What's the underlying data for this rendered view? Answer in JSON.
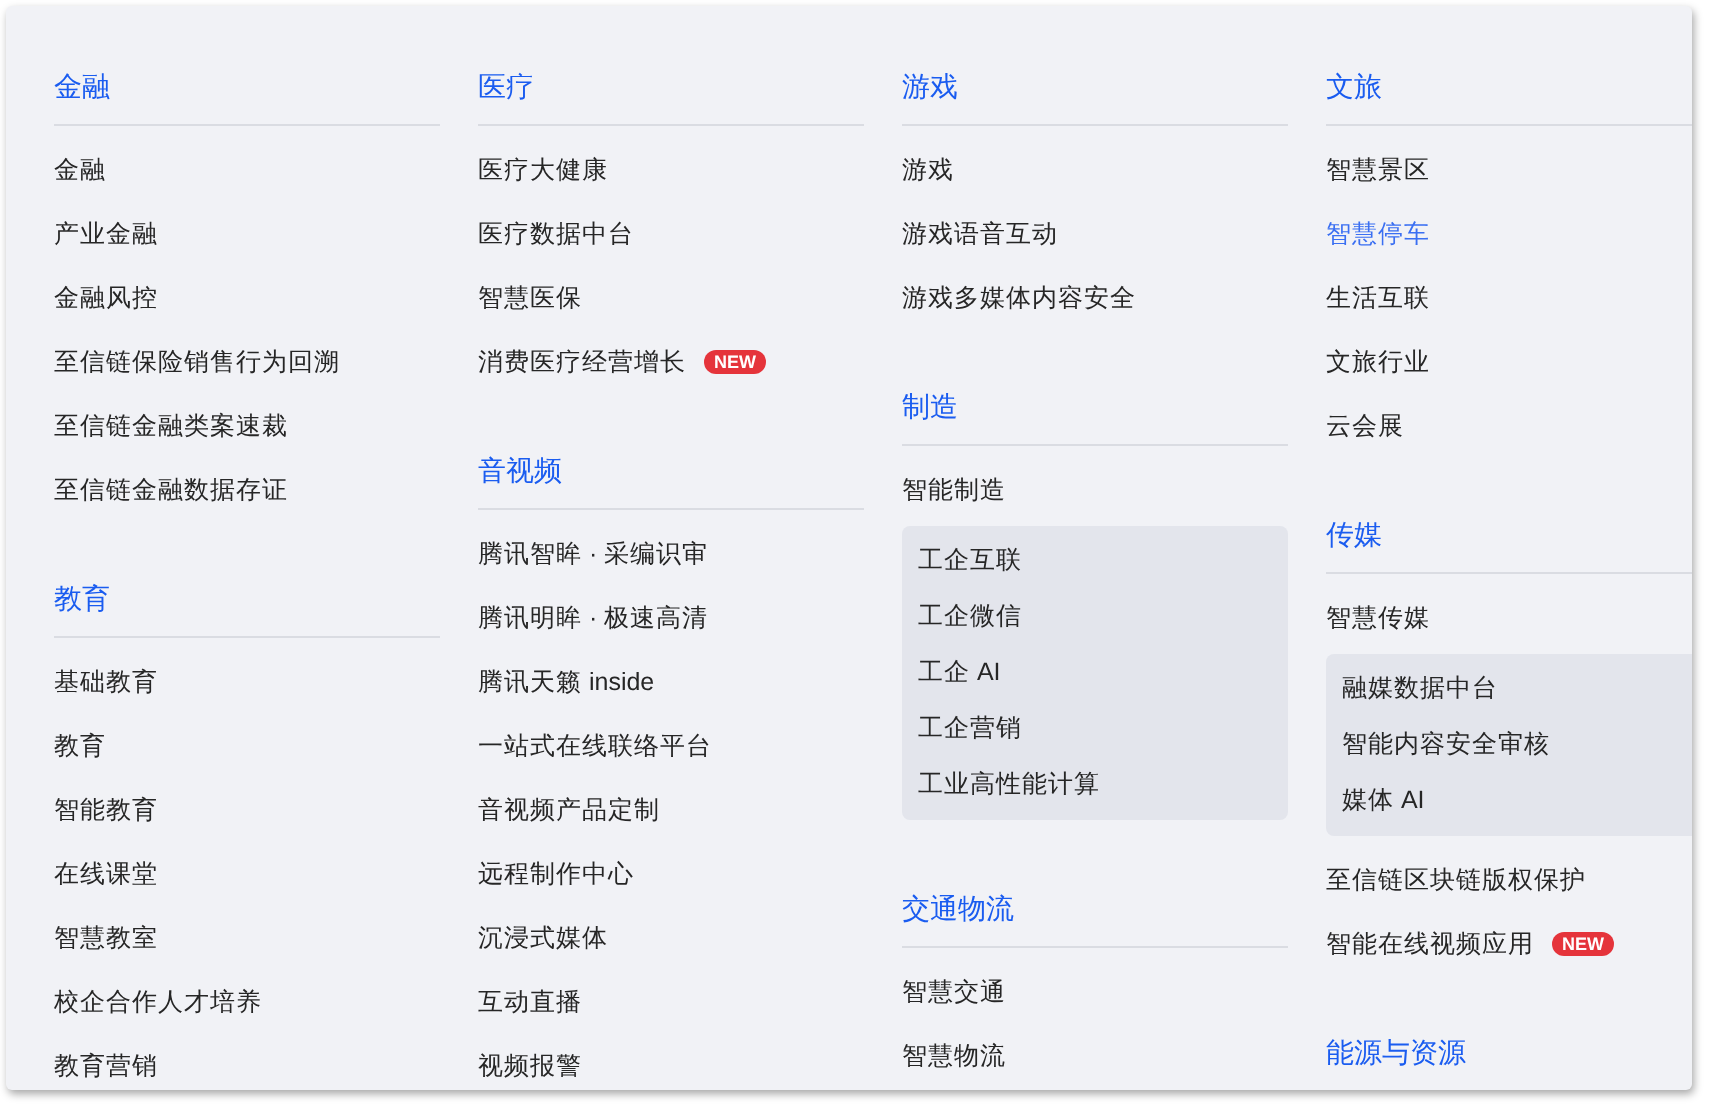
{
  "columns": [
    {
      "sections": [
        {
          "title": "金融",
          "items": [
            {
              "label": "金融",
              "hovered": false
            },
            {
              "label": "产业金融",
              "hovered": false
            },
            {
              "label": "金融风控",
              "hovered": false
            },
            {
              "label": "至信链保险销售行为回溯",
              "hovered": false
            },
            {
              "label": "至信链金融类案速裁",
              "hovered": false
            },
            {
              "label": "至信链金融数据存证",
              "hovered": false
            }
          ]
        },
        {
          "title": "教育",
          "items": [
            {
              "label": "基础教育",
              "hovered": false
            },
            {
              "label": "教育",
              "hovered": false
            },
            {
              "label": "智能教育",
              "hovered": false
            },
            {
              "label": "在线课堂",
              "hovered": false
            },
            {
              "label": "智慧教室",
              "hovered": false
            },
            {
              "label": "校企合作人才培养",
              "hovered": false
            },
            {
              "label": "教育营销",
              "hovered": false
            }
          ]
        }
      ]
    },
    {
      "sections": [
        {
          "title": "医疗",
          "items": [
            {
              "label": "医疗大健康",
              "hovered": false
            },
            {
              "label": "医疗数据中台",
              "hovered": false
            },
            {
              "label": "智慧医保",
              "hovered": false
            },
            {
              "label": "消费医疗经营增长",
              "hovered": false,
              "badge": "NEW"
            }
          ]
        },
        {
          "title": "音视频",
          "items": [
            {
              "label": "腾讯智眸 · 采编识审",
              "hovered": false
            },
            {
              "label": "腾讯明眸 · 极速高清",
              "hovered": false
            },
            {
              "label": "腾讯天籁 inside",
              "hovered": false
            },
            {
              "label": "一站式在线联络平台",
              "hovered": false
            },
            {
              "label": "音视频产品定制",
              "hovered": false
            },
            {
              "label": "远程制作中心",
              "hovered": false
            },
            {
              "label": "沉浸式媒体",
              "hovered": false
            },
            {
              "label": "互动直播",
              "hovered": false
            },
            {
              "label": "视频报警",
              "hovered": false
            }
          ]
        }
      ]
    },
    {
      "sections": [
        {
          "title": "游戏",
          "items": [
            {
              "label": "游戏",
              "hovered": false
            },
            {
              "label": "游戏语音互动",
              "hovered": false
            },
            {
              "label": "游戏多媒体内容安全",
              "hovered": false
            }
          ]
        },
        {
          "title": "制造",
          "items": [
            {
              "label": "智能制造",
              "hovered": false,
              "children": [
                {
                  "label": "工企互联",
                  "hovered": false
                },
                {
                  "label": "工企微信",
                  "hovered": false
                },
                {
                  "label": "工企 AI",
                  "hovered": false
                },
                {
                  "label": "工企营销",
                  "hovered": false
                },
                {
                  "label": "工业高性能计算",
                  "hovered": false
                }
              ]
            }
          ]
        },
        {
          "title": "交通物流",
          "items": [
            {
              "label": "智慧交通",
              "hovered": false
            },
            {
              "label": "智慧物流",
              "hovered": false
            }
          ]
        }
      ]
    },
    {
      "sections": [
        {
          "title": "文旅",
          "items": [
            {
              "label": "智慧景区",
              "hovered": false
            },
            {
              "label": "智慧停车",
              "hovered": true
            },
            {
              "label": "生活互联",
              "hovered": false
            },
            {
              "label": "文旅行业",
              "hovered": false
            },
            {
              "label": "云会展",
              "hovered": false
            }
          ]
        },
        {
          "title": "传媒",
          "items": [
            {
              "label": "智慧传媒",
              "hovered": false,
              "children": [
                {
                  "label": "融媒数据中台",
                  "hovered": false
                },
                {
                  "label": "智能内容安全审核",
                  "hovered": false
                },
                {
                  "label": "媒体 AI",
                  "hovered": false
                }
              ]
            },
            {
              "label": "至信链区块链版权保护",
              "hovered": false
            },
            {
              "label": "智能在线视频应用",
              "hovered": false,
              "badge": "NEW"
            }
          ]
        },
        {
          "title": "能源与资源"
        }
      ]
    }
  ]
}
